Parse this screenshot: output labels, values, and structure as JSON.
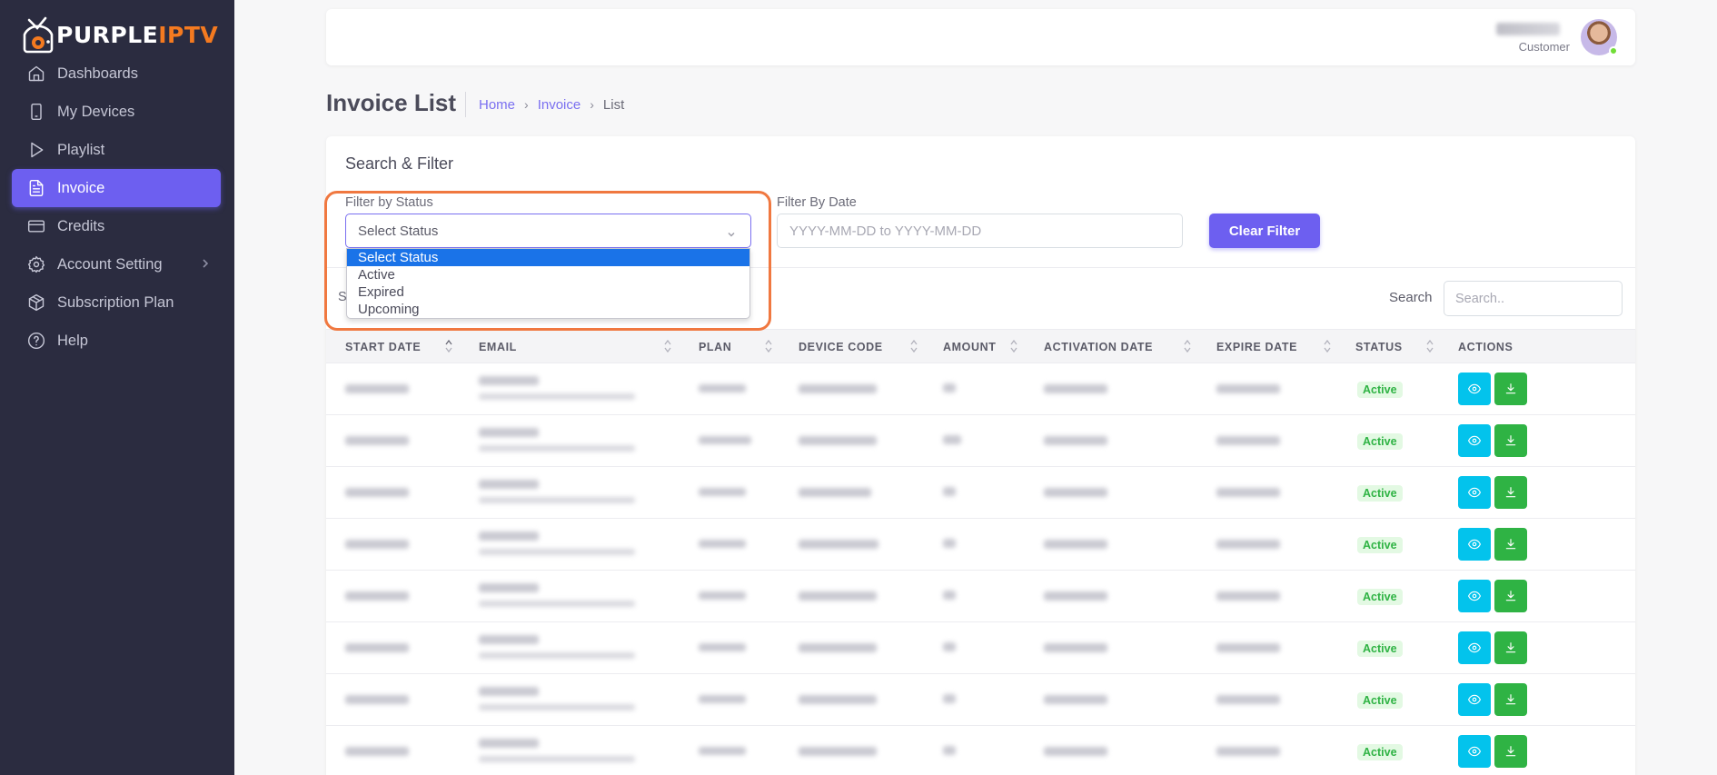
{
  "brand": {
    "part1": "PURPLE",
    "part2": "IPTV",
    "accent": "#f47a20",
    "primary": "#6d5ff0"
  },
  "sidebar": {
    "items": [
      {
        "label": "Dashboards",
        "icon": "home-icon"
      },
      {
        "label": "My Devices",
        "icon": "smartphone-icon"
      },
      {
        "label": "Playlist",
        "icon": "play-icon"
      },
      {
        "label": "Invoice",
        "icon": "file-text-icon",
        "active": true
      },
      {
        "label": "Credits",
        "icon": "credit-card-icon"
      },
      {
        "label": "Account Setting",
        "icon": "gear-icon",
        "has_submenu": true
      },
      {
        "label": "Subscription Plan",
        "icon": "package-icon"
      },
      {
        "label": "Help",
        "icon": "help-circle-icon"
      }
    ]
  },
  "header": {
    "user_role": "Customer"
  },
  "page": {
    "title": "Invoice List"
  },
  "breadcrumb": {
    "home": "Home",
    "section": "Invoice",
    "current": "List"
  },
  "filter": {
    "title": "Search & Filter",
    "status_label": "Filter by Status",
    "status_value": "Select Status",
    "status_options": [
      "Select Status",
      "Active",
      "Expired",
      "Upcoming"
    ],
    "date_label": "Filter By Date",
    "date_placeholder": "YYYY-MM-DD to YYYY-MM-DD",
    "clear_label": "Clear Filter"
  },
  "table_controls": {
    "show_prefix": "S",
    "search_label": "Search",
    "search_placeholder": "Search.."
  },
  "table": {
    "columns": [
      "START DATE",
      "EMAIL",
      "PLAN",
      "DEVICE CODE",
      "AMOUNT",
      "ACTIVATION DATE",
      "EXPIRE DATE",
      "STATUS",
      "ACTIONS"
    ],
    "rows": [
      {
        "status": "Active"
      },
      {
        "status": "Active"
      },
      {
        "status": "Active"
      },
      {
        "status": "Active"
      },
      {
        "status": "Active"
      },
      {
        "status": "Active"
      },
      {
        "status": "Active"
      },
      {
        "status": "Active"
      }
    ]
  }
}
